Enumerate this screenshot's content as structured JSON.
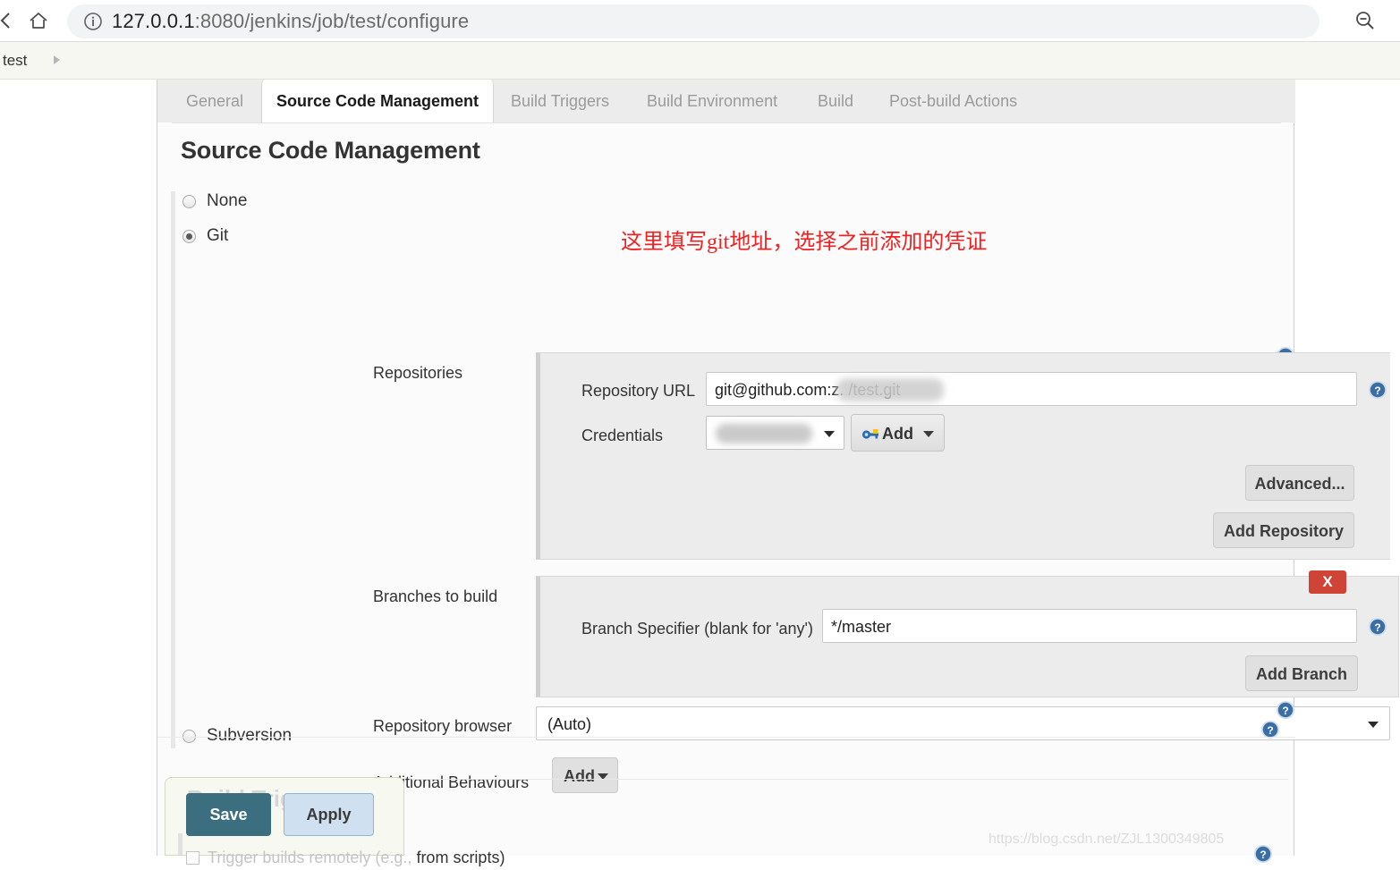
{
  "browser": {
    "url_host": "127.0.0.1",
    "url_rest": ":8080/jenkins/job/test/configure",
    "icons": {
      "back": "back-arrow-icon",
      "home": "home-icon",
      "info": "info-circle-icon",
      "zoom_out": "zoom-out-icon"
    }
  },
  "breadcrumb": {
    "items": [
      "test"
    ]
  },
  "tabs": [
    {
      "label": "General",
      "active": false
    },
    {
      "label": "Source Code Management",
      "active": true
    },
    {
      "label": "Build Triggers",
      "active": false
    },
    {
      "label": "Build Environment",
      "active": false
    },
    {
      "label": "Build",
      "active": false
    },
    {
      "label": "Post-build Actions",
      "active": false
    }
  ],
  "page": {
    "title": "Source Code Management"
  },
  "annotation": {
    "text": "这里填写git地址，选择之前添加的凭证",
    "color": "#ee2222"
  },
  "scm": {
    "options": [
      {
        "label": "None",
        "selected": false
      },
      {
        "label": "Git",
        "selected": true
      },
      {
        "label": "Subversion",
        "selected": false
      }
    ],
    "repositories": {
      "section_label": "Repositories",
      "repository_url_label": "Repository URL",
      "repository_url_value": "git@github.com:z.          /test.git",
      "credentials_label": "Credentials",
      "credentials_value": "",
      "add_credentials_label": "Add",
      "advanced_label": "Advanced...",
      "add_repository_label": "Add Repository"
    },
    "branches": {
      "section_label": "Branches to build",
      "delete_label": "X",
      "branch_specifier_label": "Branch Specifier (blank for 'any')",
      "branch_specifier_value": "*/master",
      "add_branch_label": "Add Branch"
    },
    "repository_browser": {
      "label": "Repository browser",
      "value": "(Auto)"
    },
    "additional_behaviours": {
      "label": "Additional Behaviours",
      "add_label": "Add"
    }
  },
  "build_triggers": {
    "title": "Build Triggers",
    "trigger_remote_prefix": "Trigger builds remotely (e.g.,",
    "trigger_remote_suffix": "from scripts)"
  },
  "footer": {
    "save_label": "Save",
    "apply_label": "Apply",
    "watermark": "https://blog.csdn.net/ZJL1300349805"
  },
  "colors": {
    "save_button": "#3b6f80",
    "apply_button": "#cfe0f0",
    "delete_button": "#d04437",
    "help_icon": "#3a6ea5"
  }
}
